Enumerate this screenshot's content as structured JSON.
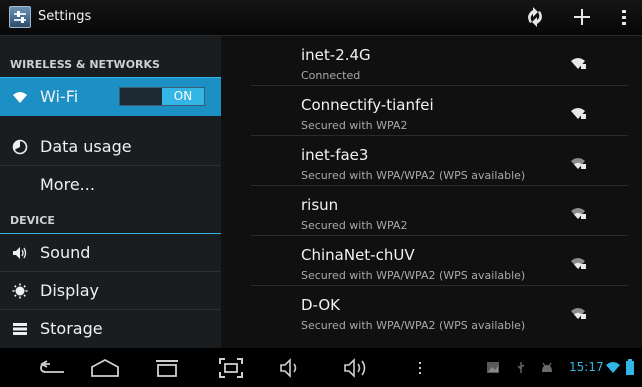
{
  "header": {
    "title": "Settings",
    "sync_icon": "sync-icon",
    "add_icon": "add-icon",
    "menu_icon": "overflow-menu-icon"
  },
  "sidebar": {
    "sections": [
      {
        "label": "WIRELESS & NETWORKS"
      },
      {
        "label": "DEVICE"
      }
    ],
    "items": [
      {
        "label": "Wi-Fi",
        "icon": "wifi-icon",
        "selected": true,
        "toggle": "ON"
      },
      {
        "label": "Data usage",
        "icon": "data-usage-icon"
      },
      {
        "label": "More..."
      },
      {
        "label": "Sound",
        "icon": "sound-icon"
      },
      {
        "label": "Display",
        "icon": "display-icon"
      },
      {
        "label": "Storage",
        "icon": "storage-icon"
      }
    ]
  },
  "networks": [
    {
      "ssid": "inet-2.4G",
      "status": "Connected"
    },
    {
      "ssid": "Connectify-tianfei",
      "status": "Secured with WPA2"
    },
    {
      "ssid": "inet-fae3",
      "status": "Secured with WPA/WPA2 (WPS available)"
    },
    {
      "ssid": "risun",
      "status": "Secured with WPA2"
    },
    {
      "ssid": "ChinaNet-chUV",
      "status": "Secured with WPA/WPA2 (WPS available)"
    },
    {
      "ssid": "D-OK",
      "status": "Secured with WPA/WPA2 (WPS available)"
    }
  ],
  "navbar": {
    "buttons": [
      "back-icon",
      "home-icon",
      "recent-apps-icon",
      "screenshot-icon",
      "volume-down-icon",
      "volume-up-icon",
      "overflow-icon"
    ],
    "status": {
      "time": "15:17",
      "icons": [
        "gallery-notification-icon",
        "usb-icon",
        "android-debug-icon",
        "wifi-signal-icon",
        "battery-icon"
      ]
    }
  },
  "colors": {
    "accent": "#33b5e5",
    "selected_bg": "#1c8fc4"
  }
}
